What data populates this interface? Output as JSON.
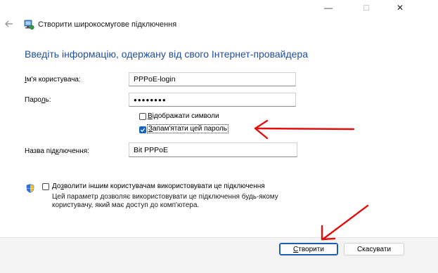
{
  "window": {
    "minimize_glyph": "—",
    "maximize_glyph": "☐",
    "close_glyph": "✕"
  },
  "wizard": {
    "title": "Створити широкосмугове підключення",
    "heading": "Введіть інформацію, одержану від свого Інтернет-провайдера"
  },
  "form": {
    "username_label_prefix": "",
    "username_label_access": "І",
    "username_label_rest": "м'я користувача:",
    "username_value": "PPPoE-login",
    "password_label_prefix": "Паро",
    "password_label_access": "л",
    "password_label_rest": "ь:",
    "password_value": "●●●●●●●●",
    "show_chars_access": "В",
    "show_chars_rest": "ідображати символи",
    "show_chars_checked": false,
    "remember_access": "З",
    "remember_rest": "апам'ятати цей пароль",
    "remember_checked": true,
    "connection_label_prefix": "Назва під",
    "connection_label_access": "к",
    "connection_label_rest": "лючення:",
    "connection_value": "Bit PPPoE"
  },
  "sharing": {
    "allow_prefix": "До",
    "allow_access": "з",
    "allow_rest": "волити іншим користувачам використовувати це підключення",
    "allow_checked": false,
    "note_line1": "Цей параметр дозволяє використовувати це підключення будь-якому",
    "note_line2": "користувачу, який має доступ до комп'ютера."
  },
  "buttons": {
    "create_access": "С",
    "create_rest": "творити",
    "cancel": "Скасувати"
  },
  "colors": {
    "heading": "#1f4e9e",
    "accent": "#1565c0",
    "annotation": "#e01010",
    "footer": "#f3f3f3"
  }
}
